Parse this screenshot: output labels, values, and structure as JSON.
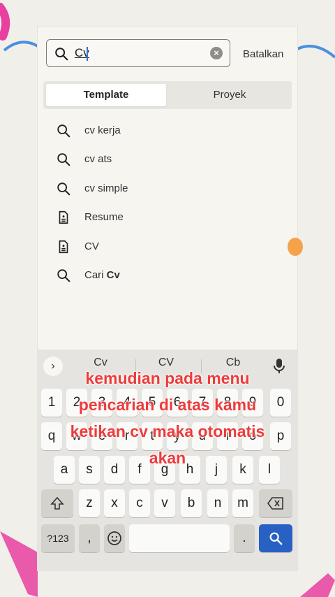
{
  "search": {
    "value": "Cv",
    "cancel_label": "Batalkan"
  },
  "tabs": [
    {
      "label": "Template",
      "active": true
    },
    {
      "label": "Proyek",
      "active": false
    }
  ],
  "suggestions": [
    {
      "icon": "search-icon",
      "text": "cv kerja"
    },
    {
      "icon": "search-icon",
      "text": "cv ats"
    },
    {
      "icon": "search-icon",
      "text": "cv simple"
    },
    {
      "icon": "document-icon",
      "text": "Resume"
    },
    {
      "icon": "document-icon",
      "text": "CV"
    },
    {
      "icon": "search-icon",
      "prefix": "Cari ",
      "bold": "Cv"
    }
  ],
  "keyboard": {
    "predictions": [
      "Cv",
      "CV",
      "Cb"
    ],
    "numbers": [
      "1",
      "2",
      "3",
      "4",
      "5",
      "6",
      "7",
      "8",
      "9",
      "0"
    ],
    "row1": [
      "q",
      "w",
      "e",
      "r",
      "t",
      "y",
      "u",
      "i",
      "o",
      "p"
    ],
    "row2": [
      "a",
      "s",
      "d",
      "f",
      "g",
      "h",
      "j",
      "k",
      "l"
    ],
    "row3": [
      "z",
      "x",
      "c",
      "v",
      "b",
      "n",
      "m"
    ],
    "symbols_label": "?123",
    "comma": ",",
    "period": "."
  },
  "overlay": {
    "lines": [
      "kemudian pada menu",
      "pencarian di atas kamu",
      "ketikan cv maka otomatis",
      "akan"
    ],
    "color": "#ee3b3b"
  },
  "colors": {
    "search_key": "#2761c4",
    "accent_orange": "#f6a24a",
    "deco_pink": "#e83fa0",
    "deco_blue": "#4a8fe0"
  }
}
